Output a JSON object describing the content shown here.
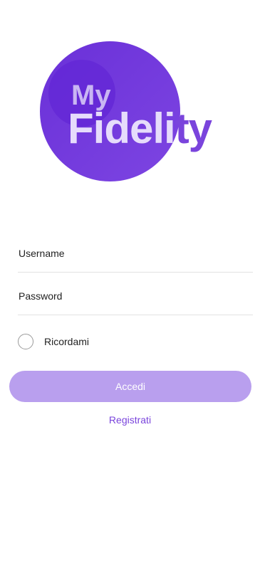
{
  "logo": {
    "prefix": "My",
    "word_light": "Fideli",
    "word_dark": "ty",
    "colors": {
      "circle": "#7040de",
      "circle_inner": "#6428d6",
      "text_light": "#e6dcfb",
      "text_dark": "#7a44dc"
    }
  },
  "form": {
    "username_label": "Username",
    "password_label": "Password",
    "remember_label": "Ricordami",
    "remember_checked": false,
    "login_button": "Accedi",
    "register_link": "Registrati"
  },
  "colors": {
    "accent": "#7a44dc",
    "button_bg": "#b99fee",
    "divider": "#e2e2e2"
  }
}
